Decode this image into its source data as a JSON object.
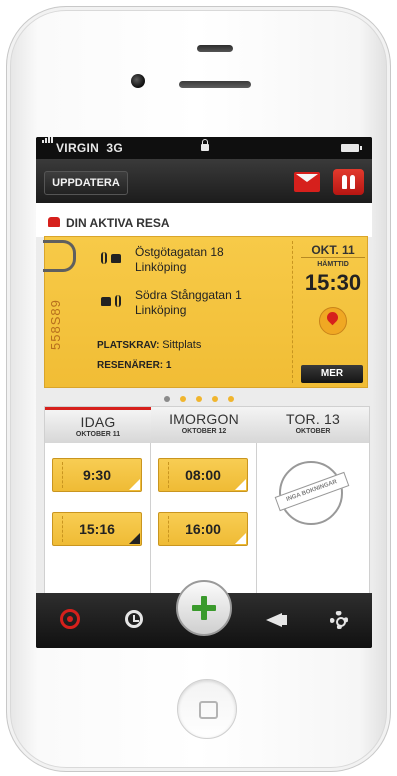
{
  "status_bar": {
    "carrier": "VIRGIN",
    "network": "3G"
  },
  "nav": {
    "update_label": "UPPDATERA"
  },
  "active_trip": {
    "heading": "DIN AKTIVA RESA",
    "ticket_id": "558S89",
    "from": {
      "street": "Östgötagatan 18",
      "city": "Linköping"
    },
    "to": {
      "street": "Södra Stånggatan 1",
      "city": "Linköping"
    },
    "seat_label": "PLATSKRAV:",
    "seat_value": "Sittplats",
    "passengers_label": "RESENÄRER:",
    "passengers_value": "1",
    "date": "OKT. 11",
    "pickup_label": "HÄMTTID",
    "pickup_time": "15:30",
    "more_label": "MER"
  },
  "pager": {
    "total": 5,
    "active_index": 0
  },
  "days": [
    {
      "name": "IDAG",
      "date": "OKTOBER 11",
      "trips": [
        "9:30",
        "15:16"
      ]
    },
    {
      "name": "IMORGON",
      "date": "OKTOBER 12",
      "trips": [
        "08:00",
        "16:00"
      ]
    },
    {
      "name": "TOR. 13",
      "date": "OKTOBER",
      "stamp_text": "INGA BOKNINGAR"
    }
  ],
  "tabbar": {
    "icons": [
      "target-icon",
      "history-icon",
      "plus-icon",
      "megaphone-icon",
      "gear-icon"
    ]
  },
  "colors": {
    "accent_red": "#d6201c",
    "ticket_yellow": "#f5c43e",
    "plus_green": "#3a9a2c"
  }
}
